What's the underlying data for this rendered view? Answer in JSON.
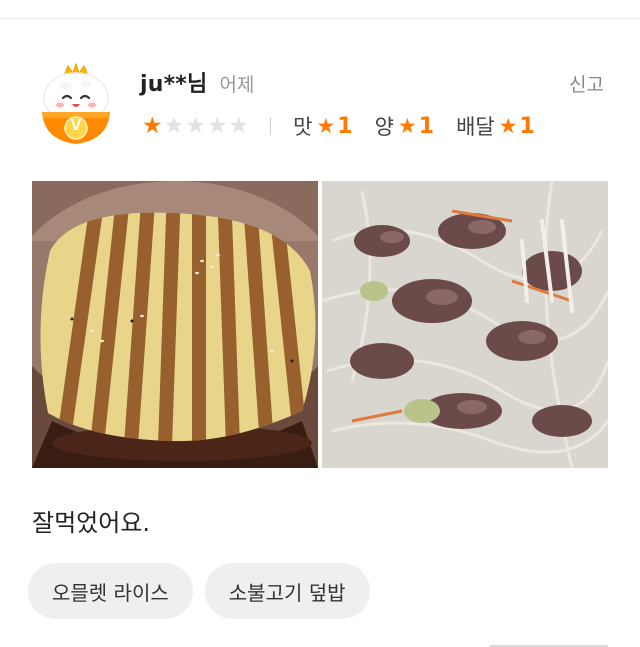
{
  "review": {
    "username": "ju**님",
    "date": "어제",
    "report_label": "신고",
    "avatar_badge": "V",
    "overall_rating": 1,
    "overall_max": 5,
    "sub_ratings": [
      {
        "label": "맛",
        "value": "1"
      },
      {
        "label": "양",
        "value": "1"
      },
      {
        "label": "배달",
        "value": "1"
      }
    ],
    "photos": [
      {
        "subject": "omelette-rice"
      },
      {
        "subject": "bulgogi-rice-bowl"
      }
    ],
    "text": "잘먹었어요.",
    "menu_tags": [
      "오믈렛 라이스",
      "소불고기 덮밥"
    ]
  },
  "colors": {
    "accent": "#ff7a00",
    "star_off": "#e2e2e2",
    "tag_bg": "#efefef",
    "muted_text": "#999999"
  },
  "icons": {
    "avatar": "vip-rice-bowl-icon",
    "star": "star-icon"
  }
}
